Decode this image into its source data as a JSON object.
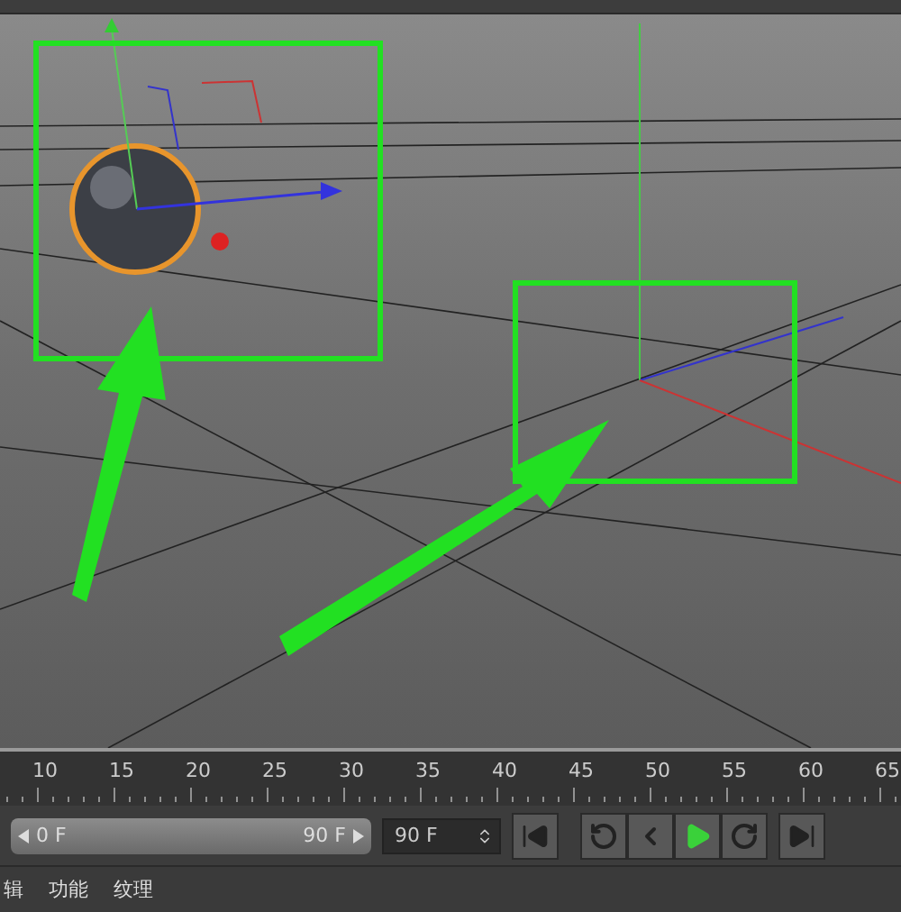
{
  "timeline": {
    "ticks": [
      "10",
      "15",
      "20",
      "25",
      "30",
      "35",
      "40",
      "45",
      "50",
      "55",
      "60",
      "65"
    ]
  },
  "playback": {
    "level": 1,
    "range_start": "0 F",
    "range_end": "90 F",
    "end_frame": "90 F"
  },
  "bottom_menu": [
    "辑",
    "功能",
    "纹理"
  ]
}
